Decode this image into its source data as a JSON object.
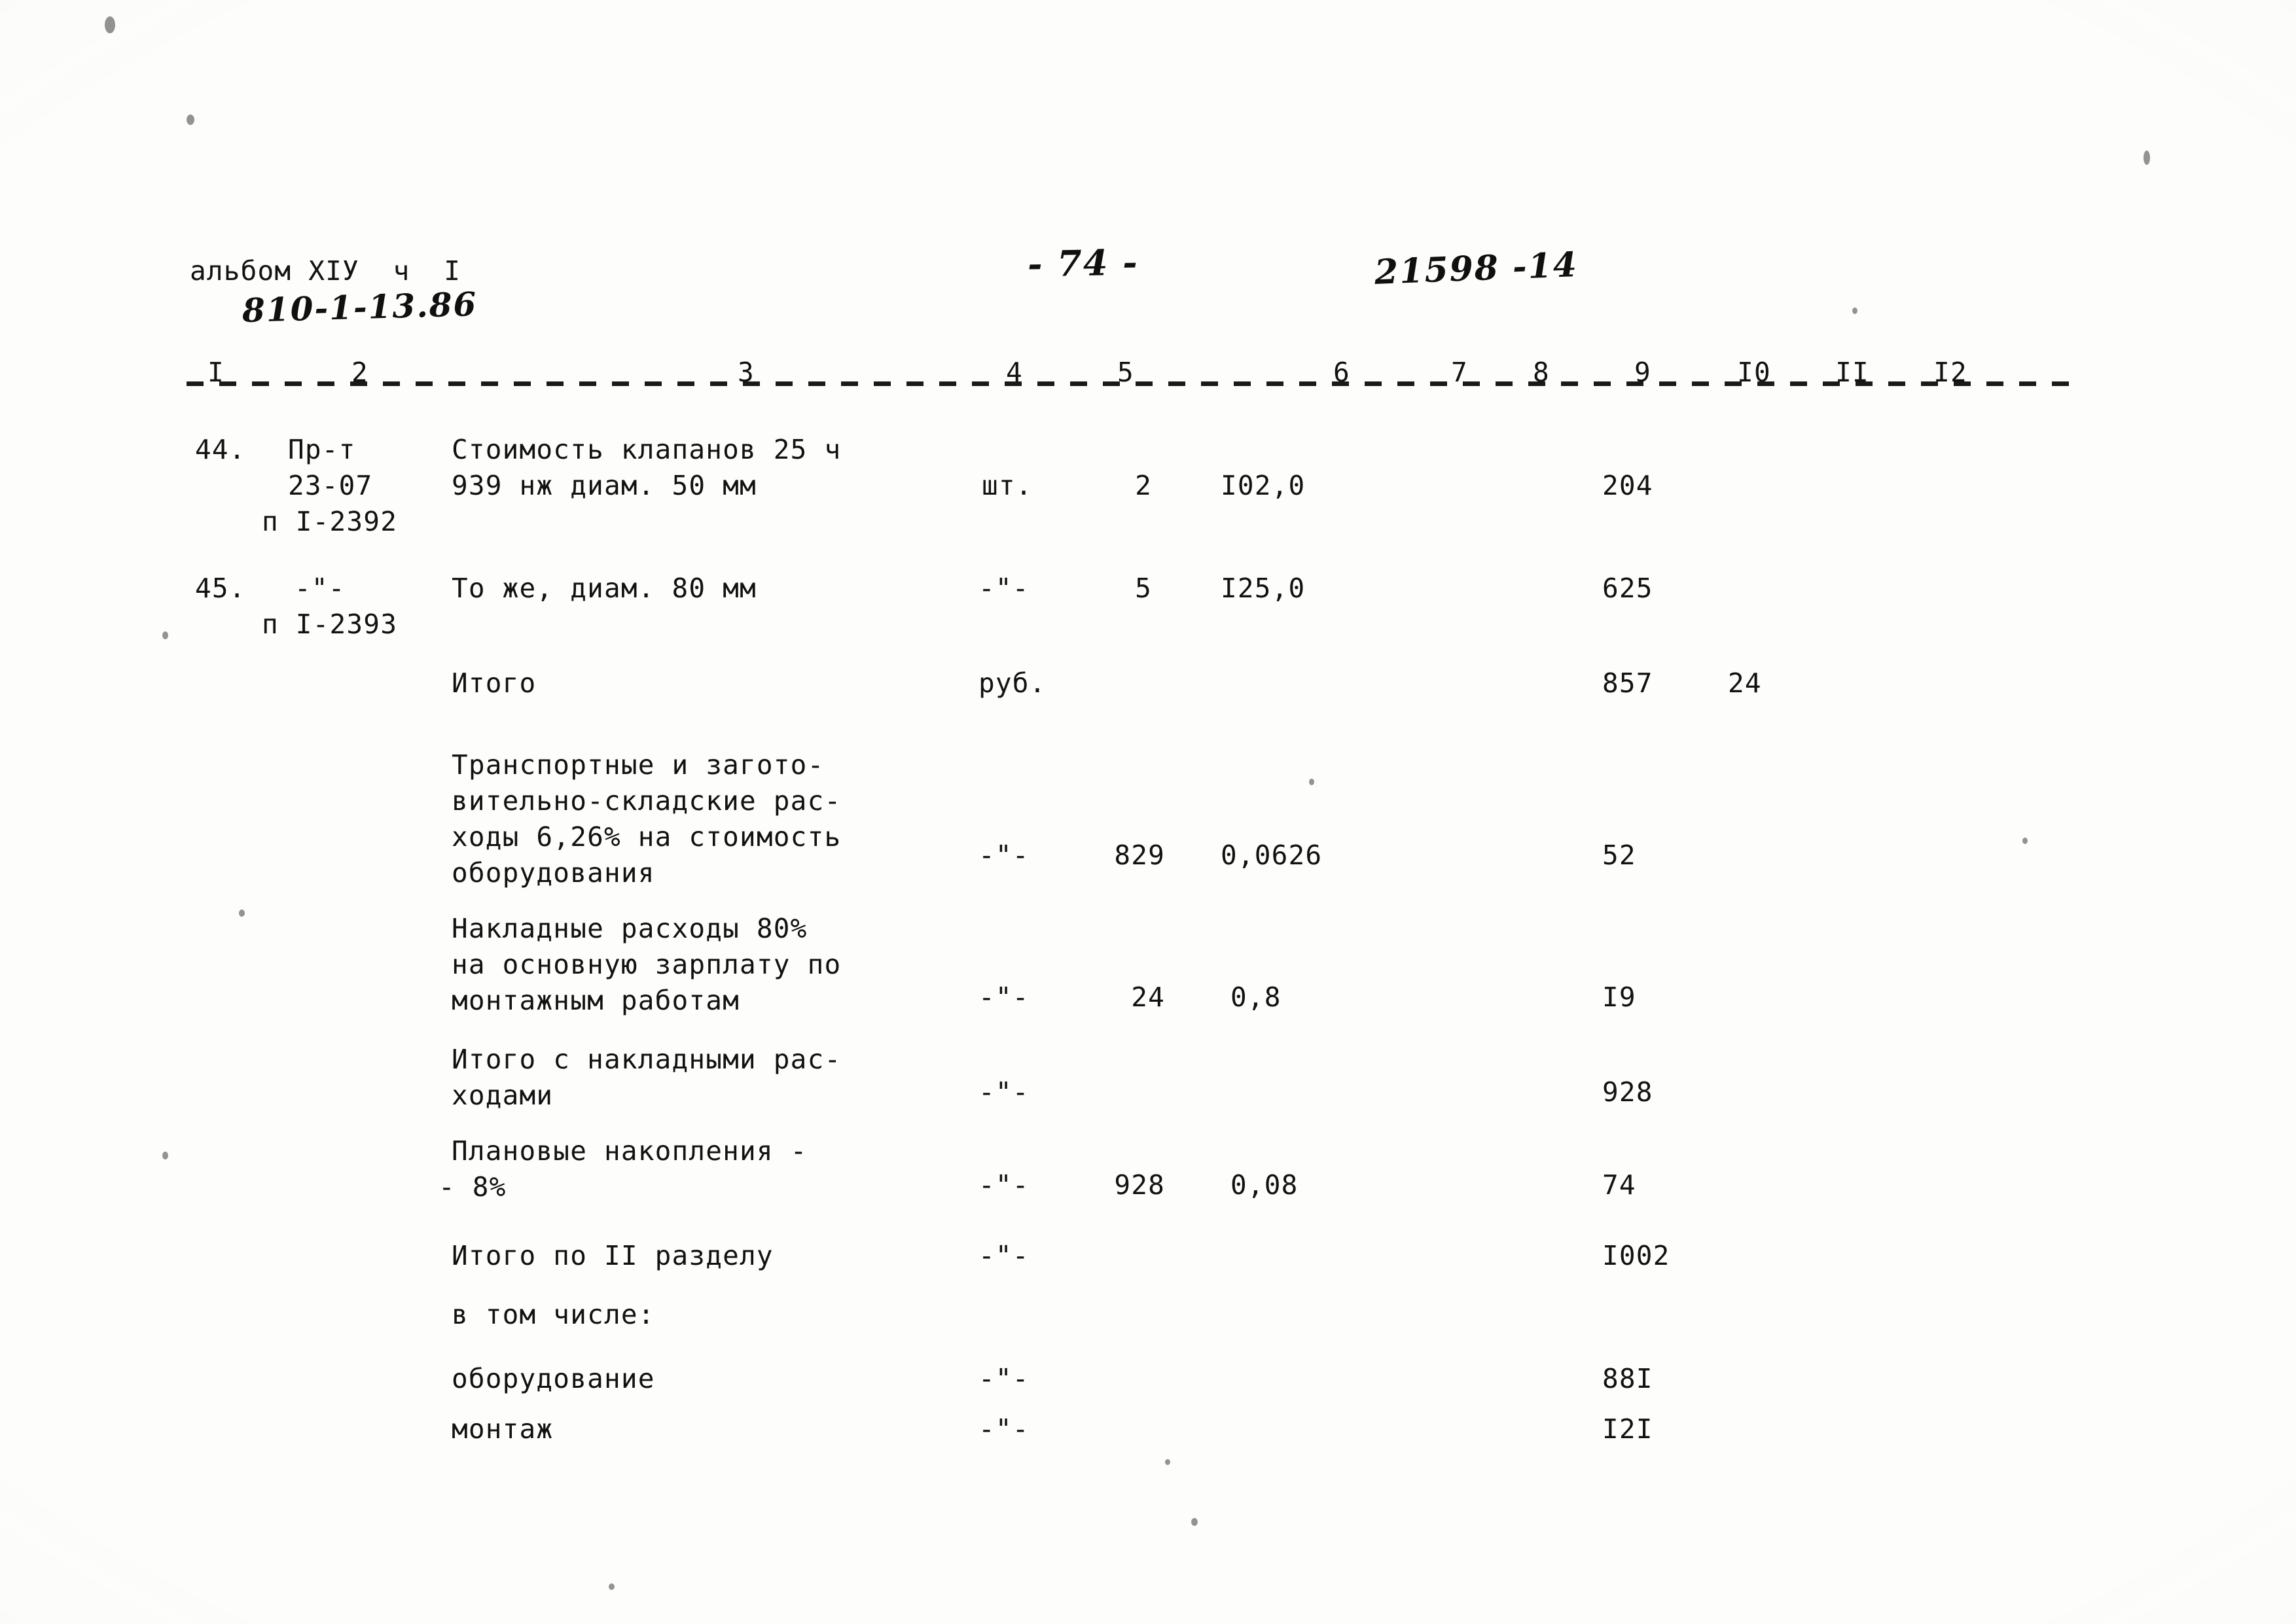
{
  "header": {
    "album_line": "альбом XIУ  ч  I",
    "album_code_handwritten": "810-1-13.86",
    "page_number_handwritten": "- 74 -",
    "doc_stamp_handwritten": "21598 -14"
  },
  "table": {
    "column_headers": [
      "I",
      "2",
      "3",
      "4",
      "5",
      "6",
      "7",
      "8",
      "9",
      "I0",
      "II",
      "I2"
    ],
    "ditto_mark": "-\"-",
    "rows": [
      {
        "num": "44.",
        "code_lines": [
          "Пр-т",
          "23-07",
          "п I-2392"
        ],
        "desc_lines": [
          "Стоимость клапанов 25 ч",
          "939 нж диам. 50 мм"
        ],
        "unit": "шт.",
        "qty": "2",
        "price": "I02,0",
        "total": "204",
        "extra": ""
      },
      {
        "num": "45.",
        "code_lines": [
          "-\"-",
          "п I-2393"
        ],
        "desc_lines": [
          "То же, диам. 80 мм"
        ],
        "unit": "-\"-",
        "qty": "5",
        "price": "I25,0",
        "total": "625",
        "extra": ""
      },
      {
        "num": "",
        "code_lines": [],
        "desc_lines": [
          "Итого"
        ],
        "unit": "руб.",
        "qty": "",
        "price": "",
        "total": "857",
        "extra": "24"
      },
      {
        "num": "",
        "code_lines": [],
        "desc_lines": [
          "Транспортные и загото-",
          "вительно-складские рас-",
          "ходы 6,26% на стоимость",
          "оборудования"
        ],
        "unit": "-\"-",
        "qty": "829",
        "price": "0,0626",
        "total": "52",
        "extra": ""
      },
      {
        "num": "",
        "code_lines": [],
        "desc_lines": [
          "Накладные расходы 80%",
          "на основную зарплату по",
          "монтажным работам"
        ],
        "unit": "-\"-",
        "qty": "24",
        "price": "0,8",
        "total": "I9",
        "extra": ""
      },
      {
        "num": "",
        "code_lines": [],
        "desc_lines": [
          "Итого с накладными рас-",
          "ходами"
        ],
        "unit": "-\"-",
        "qty": "",
        "price": "",
        "total": "928",
        "extra": ""
      },
      {
        "num": "",
        "code_lines": [],
        "desc_lines": [
          "Плановые накопления -",
          "- 8%"
        ],
        "unit": "-\"-",
        "qty": "928",
        "price": "0,08",
        "total": "74",
        "extra": ""
      },
      {
        "num": "",
        "code_lines": [],
        "desc_lines": [
          "Итого по II разделу"
        ],
        "unit": "-\"-",
        "qty": "",
        "price": "",
        "total": "I002",
        "extra": ""
      },
      {
        "num": "",
        "code_lines": [],
        "desc_lines": [
          "в том числе:"
        ],
        "unit": "",
        "qty": "",
        "price": "",
        "total": "",
        "extra": ""
      },
      {
        "num": "",
        "code_lines": [],
        "desc_lines": [
          "оборудование"
        ],
        "unit": "-\"-",
        "qty": "",
        "price": "",
        "total": "88I",
        "extra": ""
      },
      {
        "num": "",
        "code_lines": [],
        "desc_lines": [
          "монтаж"
        ],
        "unit": "-\"-",
        "qty": "",
        "price": "",
        "total": "I2I",
        "extra": ""
      }
    ]
  },
  "colors": {
    "paper": "#fdfdfb",
    "ink": "#121212"
  }
}
